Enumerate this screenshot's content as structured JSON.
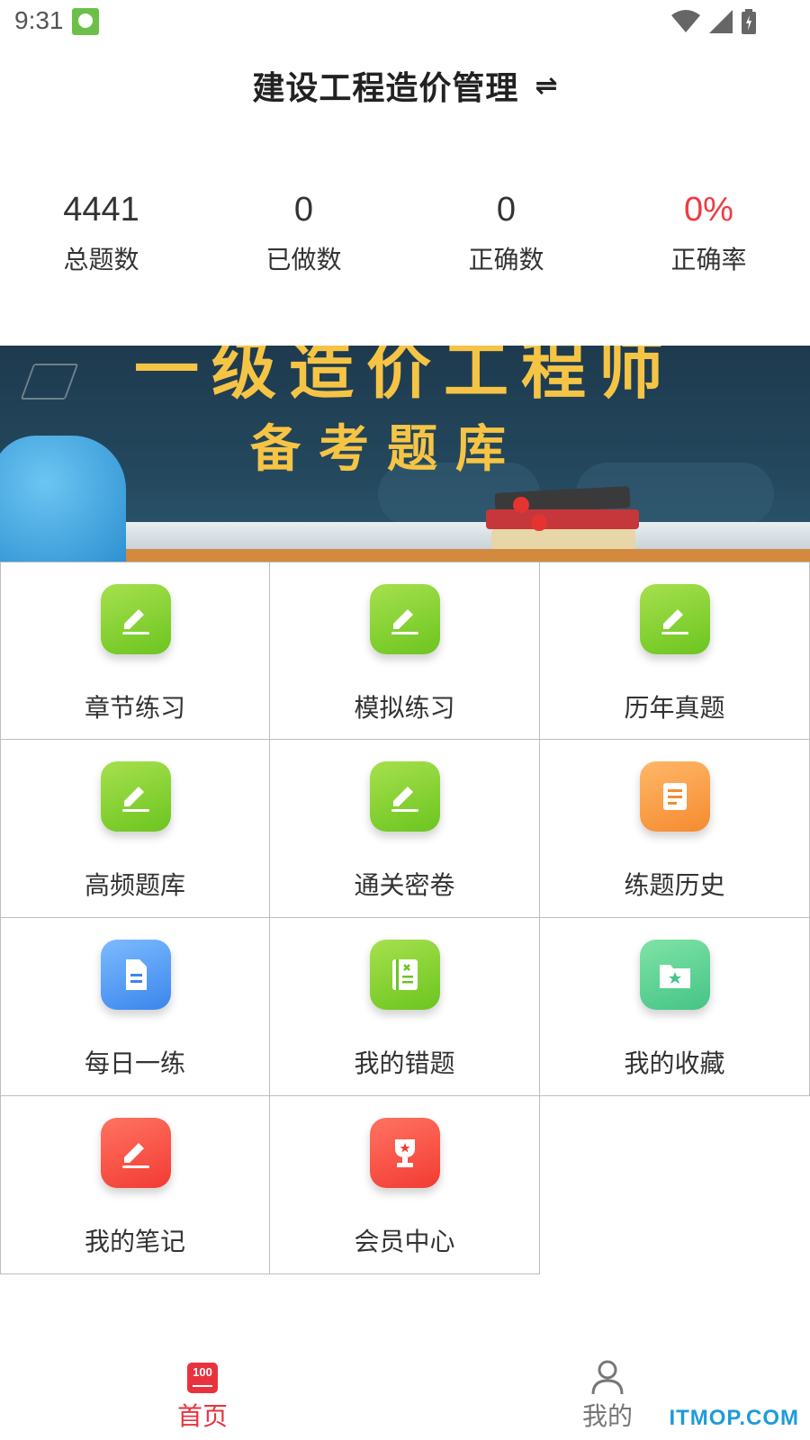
{
  "status_bar": {
    "time": "9:31",
    "icons": [
      "app-notification-icon",
      "wifi-icon",
      "signal-icon",
      "battery-icon"
    ]
  },
  "header": {
    "title": "建设工程造价管理",
    "switch_icon": "⇌"
  },
  "stats": [
    {
      "value": "4441",
      "label": "总题数"
    },
    {
      "value": "0",
      "label": "已做数"
    },
    {
      "value": "0",
      "label": "正确数"
    },
    {
      "value": "0%",
      "label": "正确率",
      "color": "#ef3a42"
    }
  ],
  "banner": {
    "title": "一级造价工程师",
    "subtitle": "备考题库"
  },
  "menu": [
    {
      "label": "章节练习",
      "icon": "edit-icon",
      "color": "green"
    },
    {
      "label": "模拟练习",
      "icon": "edit-icon",
      "color": "green"
    },
    {
      "label": "历年真题",
      "icon": "edit-icon",
      "color": "green"
    },
    {
      "label": "高频题库",
      "icon": "edit-icon",
      "color": "green"
    },
    {
      "label": "通关密卷",
      "icon": "edit-icon",
      "color": "green"
    },
    {
      "label": "练题历史",
      "icon": "scroll-icon",
      "color": "orange"
    },
    {
      "label": "每日一练",
      "icon": "document-icon",
      "color": "blue"
    },
    {
      "label": "我的错题",
      "icon": "notebook-icon",
      "color": "green"
    },
    {
      "label": "我的收藏",
      "icon": "folder-star-icon",
      "color": "mint"
    },
    {
      "label": "我的笔记",
      "icon": "pencil-icon",
      "color": "red"
    },
    {
      "label": "会员中心",
      "icon": "trophy-icon",
      "color": "red"
    }
  ],
  "bottom_nav": {
    "home": {
      "label": "首页",
      "icon_text": "100"
    },
    "mine": {
      "label": "我的"
    }
  },
  "watermark": "ITMOP.COM",
  "colors": {
    "accent": "#ef3a42",
    "nav_active": "#e8333e",
    "watermark": "#1f9bd8"
  }
}
